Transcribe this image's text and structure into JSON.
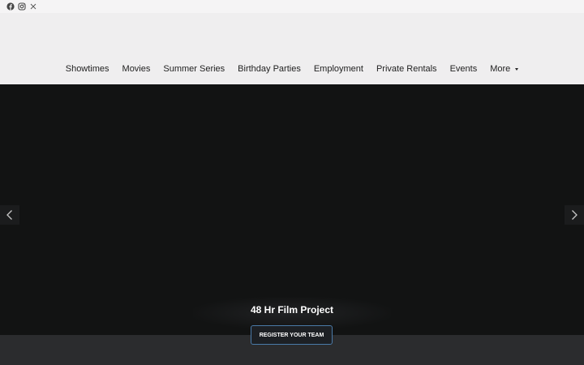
{
  "social": {
    "icons": [
      "facebook-icon",
      "instagram-icon",
      "x-icon"
    ]
  },
  "nav": {
    "items": [
      {
        "label": "Showtimes"
      },
      {
        "label": "Movies"
      },
      {
        "label": "Summer Series"
      },
      {
        "label": "Birthday Parties"
      },
      {
        "label": "Employment"
      },
      {
        "label": "Private Rentals"
      },
      {
        "label": "Events"
      },
      {
        "label": "More"
      }
    ]
  },
  "hero": {
    "title": "48 Hr Film Project",
    "cta_label": "REGISTER YOUR TEAM",
    "prev_icon": "chevron-left-icon",
    "next_icon": "chevron-right-icon"
  },
  "colors": {
    "header_bg": "#efeeef",
    "hero_bg": "#121313",
    "cta_border": "#4a7aa8",
    "nav_text": "#222222"
  }
}
